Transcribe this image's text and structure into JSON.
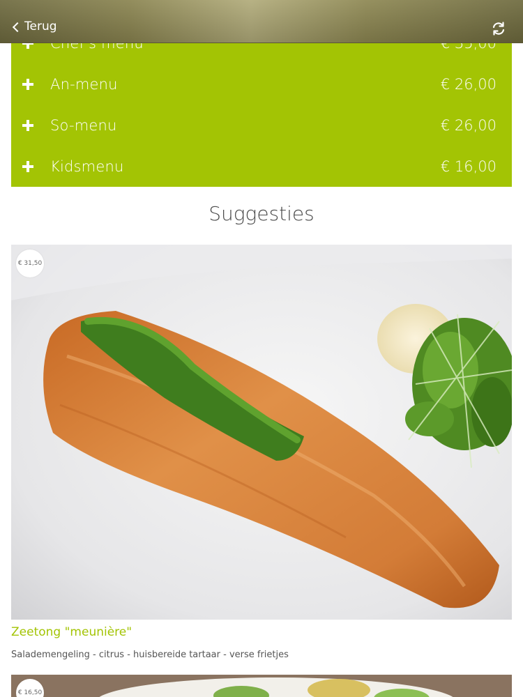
{
  "nav": {
    "back_label": "Terug",
    "refresh_icon": "refresh-icon",
    "back_icon": "chevron-left-icon"
  },
  "menus": [
    {
      "name": "Chef's menu",
      "price": "€ 35,00"
    },
    {
      "name": "An-menu",
      "price": "€ 26,00"
    },
    {
      "name": "So-menu",
      "price": "€ 26,00"
    },
    {
      "name": "Kidsmenu",
      "price": "€ 16,00"
    }
  ],
  "suggestions": {
    "title": "Suggesties",
    "items": [
      {
        "price": "€ 31,50",
        "name": "Zeetong \"meunière\"",
        "description": "Salademengeling - citrus - huisbereide tartaar - verse frietjes"
      },
      {
        "price": "€ 16,50"
      }
    ]
  },
  "colors": {
    "accent": "#a3c404",
    "nav_bar": "#8a8450",
    "title_text": "#4a4a4a"
  }
}
